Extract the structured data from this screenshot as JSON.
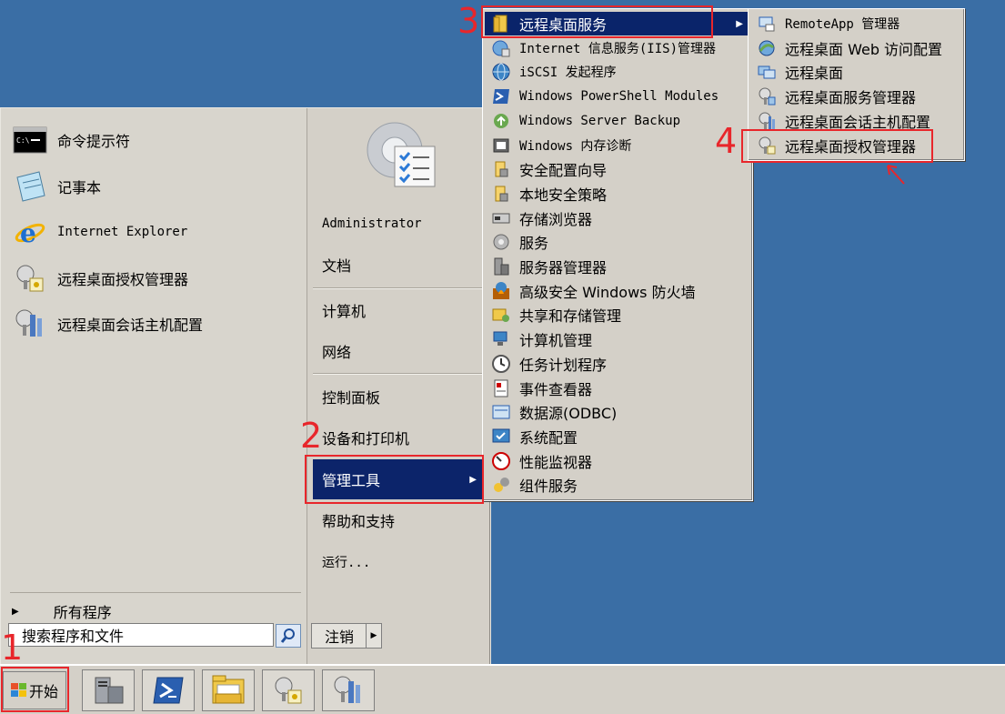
{
  "start_menu": {
    "pinned": [
      {
        "label": "命令提示符",
        "icon": "cmd-icon"
      },
      {
        "label": "记事本",
        "icon": "notepad-icon"
      },
      {
        "label": "Internet Explorer",
        "icon": "ie-icon"
      },
      {
        "label": "远程桌面授权管理器",
        "icon": "license-manager-icon"
      },
      {
        "label": "远程桌面会话主机配置",
        "icon": "session-host-config-icon"
      }
    ],
    "all_programs": "所有程序",
    "search_placeholder": "搜索程序和文件",
    "right": {
      "user": "Administrator",
      "documents": "文档",
      "computer": "计算机",
      "network": "网络",
      "control_panel": "控制面板",
      "devices_printers": "设备和打印机",
      "admin_tools": "管理工具",
      "help_support": "帮助和支持",
      "run": "运行...",
      "logoff": "注销"
    }
  },
  "admin_tools_menu": {
    "items": [
      {
        "label": "远程桌面服务",
        "icon": "folder-icon"
      },
      {
        "label": "Internet 信息服务(IIS)管理器",
        "icon": "iis-icon"
      },
      {
        "label": "iSCSI 发起程序",
        "icon": "iscsi-icon"
      },
      {
        "label": "Windows PowerShell Modules",
        "icon": "powershell-icon"
      },
      {
        "label": "Windows Server Backup",
        "icon": "backup-icon"
      },
      {
        "label": "Windows 内存诊断",
        "icon": "memory-icon"
      },
      {
        "label": "安全配置向导",
        "icon": "security-wizard-icon"
      },
      {
        "label": "本地安全策略",
        "icon": "security-policy-icon"
      },
      {
        "label": "存储浏览器",
        "icon": "storage-icon"
      },
      {
        "label": "服务",
        "icon": "services-icon"
      },
      {
        "label": "服务器管理器",
        "icon": "server-manager-icon"
      },
      {
        "label": "高级安全 Windows 防火墙",
        "icon": "firewall-icon"
      },
      {
        "label": "共享和存储管理",
        "icon": "share-icon"
      },
      {
        "label": "计算机管理",
        "icon": "computer-management-icon"
      },
      {
        "label": "任务计划程序",
        "icon": "clock-icon"
      },
      {
        "label": "事件查看器",
        "icon": "event-viewer-icon"
      },
      {
        "label": "数据源(ODBC)",
        "icon": "odbc-icon"
      },
      {
        "label": "系统配置",
        "icon": "msconfig-icon"
      },
      {
        "label": "性能监视器",
        "icon": "perfmon-icon"
      },
      {
        "label": "组件服务",
        "icon": "component-icon"
      }
    ]
  },
  "rds_menu": {
    "items": [
      {
        "label": "RemoteApp 管理器",
        "icon": "remoteapp-icon"
      },
      {
        "label": "远程桌面 Web 访问配置",
        "icon": "web-access-icon"
      },
      {
        "label": "远程桌面",
        "icon": "remote-desktop-icon"
      },
      {
        "label": "远程桌面服务管理器",
        "icon": "rds-manager-icon"
      },
      {
        "label": "远程桌面会话主机配置",
        "icon": "session-host-config-icon"
      },
      {
        "label": "远程桌面授权管理器",
        "icon": "license-manager-icon"
      }
    ]
  },
  "taskbar": {
    "start_label": "开始",
    "buttons": [
      "server-manager-icon",
      "powershell-icon",
      "explorer-icon",
      "license-manager-icon",
      "session-host-config-icon"
    ]
  },
  "annotations": {
    "step1": "1",
    "step2": "2",
    "step3": "3",
    "step4": "4"
  },
  "colors": {
    "desktop": "#3a6ea5",
    "highlight": "#0a246a",
    "annotation": "#e8262b"
  }
}
